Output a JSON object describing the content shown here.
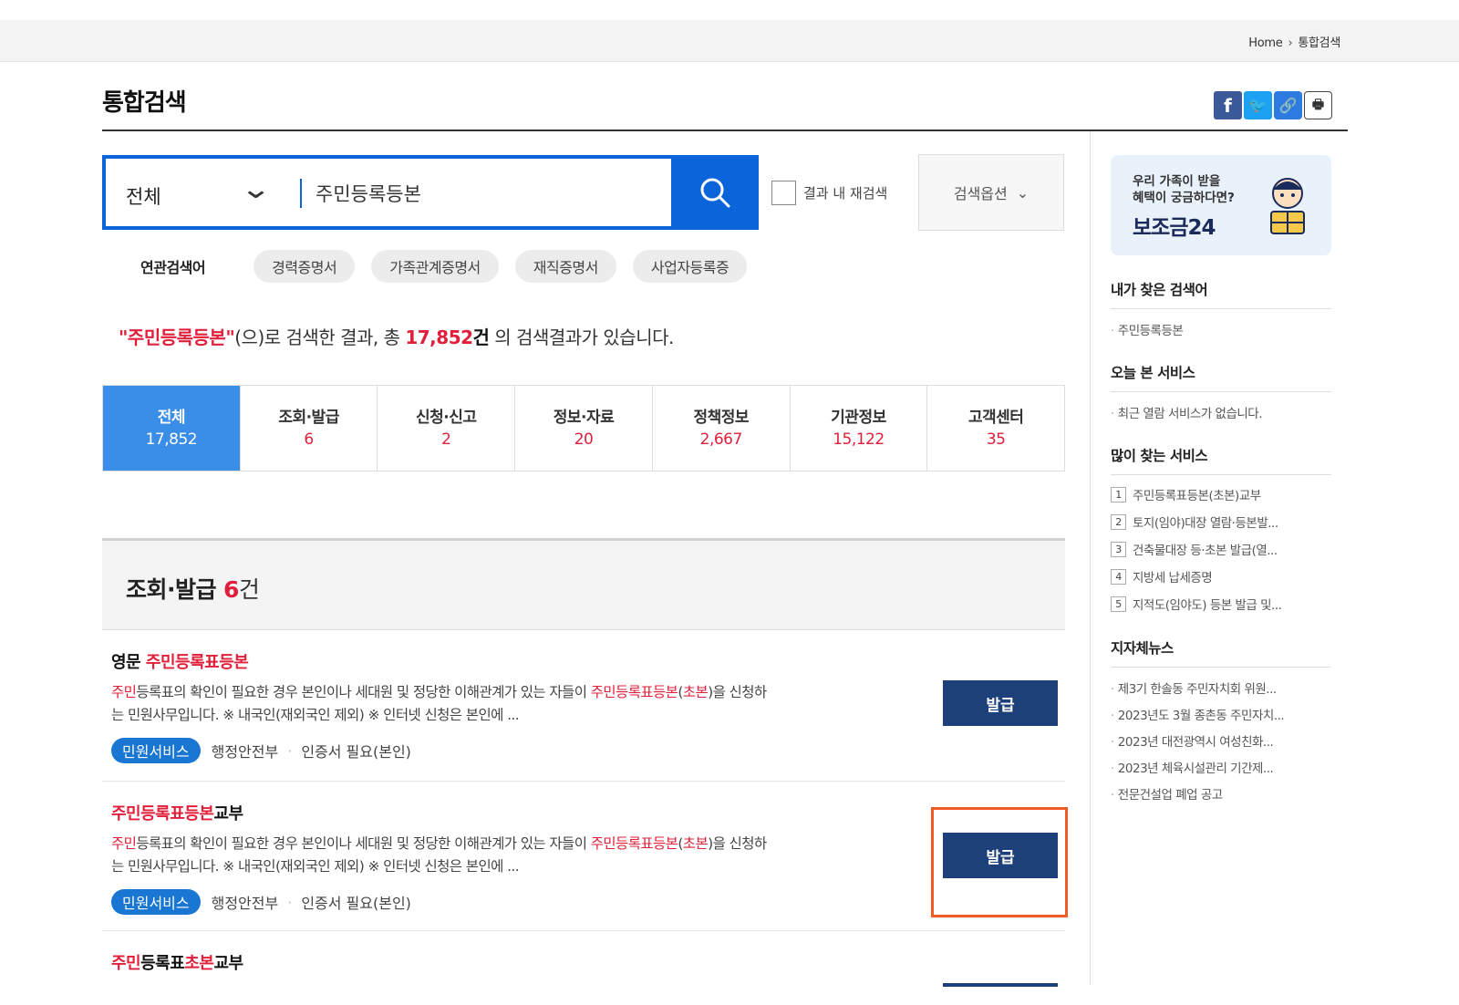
{
  "breadcrumb": {
    "home": "Home",
    "current": "통합검색"
  },
  "page_title": "통합검색",
  "share": {
    "facebook": "f",
    "twitter": "🐦",
    "link": "🔗",
    "print": "🖶"
  },
  "search": {
    "scope": "전체",
    "query": "주민등록등본",
    "research_label": "결과 내 재검색",
    "options_label": "검색옵션"
  },
  "related": {
    "label": "연관검색어",
    "terms": [
      "경력증명서",
      "가족관계증명서",
      "재직증명서",
      "사업자등록증"
    ]
  },
  "summary": {
    "keyword": "\"주민등록등본\"",
    "mid": "(으)로 검색한 결과, 총 ",
    "total": "17,852",
    "unit": "건",
    "tail": " 의 검색결과가 있습니다."
  },
  "tabs": [
    {
      "label": "전체",
      "count": "17,852",
      "active": true
    },
    {
      "label": "조회·발급",
      "count": "6"
    },
    {
      "label": "신청·신고",
      "count": "2"
    },
    {
      "label": "정보·자료",
      "count": "20"
    },
    {
      "label": "정책정보",
      "count": "2,667"
    },
    {
      "label": "기관정보",
      "count": "15,122"
    },
    {
      "label": "고객센터",
      "count": "35"
    }
  ],
  "section": {
    "title": "조회·발급",
    "count": "6",
    "unit": "건"
  },
  "results": [
    {
      "title_pre": "영문 ",
      "title_red": "주민등록표등본",
      "title_post": "",
      "desc_a": "주민",
      "desc_b": "등록표의 확인이 필요한 경우 본인이나 세대원 및 정당한 이해관계가 있는 자들이 ",
      "desc_c": "주민등록표등본",
      "desc_d": "(",
      "desc_e": "초본",
      "desc_f": ")을 신청하",
      "desc_line2": "는 민원사무입니다. ※ 내국인(재외국인 제외) ※ 인터넷 신청은 본인에 ...",
      "badge": "민원서비스",
      "agency": "행정안전부",
      "cert": "인증서 필요(본인)",
      "button": "발급"
    },
    {
      "title_pre": "",
      "title_red": "주민등록표등본",
      "title_post": "교부",
      "desc_a": "주민",
      "desc_b": "등록표의 확인이 필요한 경우 본인이나 세대원 및 정당한 이해관계가 있는 자들이 ",
      "desc_c": "주민등록표등본",
      "desc_d": "(",
      "desc_e": "초본",
      "desc_f": ")을 신청하",
      "desc_line2": "는 민원사무입니다. ※ 내국인(재외국인 제외) ※ 인터넷 신청은 본인에 ...",
      "badge": "민원서비스",
      "agency": "행정안전부",
      "cert": "인증서 필요(본인)",
      "button": "발급"
    },
    {
      "title_a": "주민",
      "title_b": "등록표",
      "title_c": "초본",
      "title_d": "교부"
    }
  ],
  "sidebar": {
    "banner_line1": "우리 가족이 받을",
    "banner_line2": "혜택이 궁금하다면?",
    "banner_title": "보조금24",
    "my_searches_title": "내가 찾은 검색어",
    "my_searches": [
      "주민등록등본"
    ],
    "today_title": "오늘 본 서비스",
    "today": [
      "최근 열람 서비스가 없습니다."
    ],
    "popular_title": "많이 찾는 서비스",
    "popular": [
      {
        "rank": "1",
        "label": "주민등록표등본(초본)교부"
      },
      {
        "rank": "2",
        "label": "토지(임야)대장 열람·등본발..."
      },
      {
        "rank": "3",
        "label": "건축물대장 등·초본 발급(열..."
      },
      {
        "rank": "4",
        "label": "지방세 납세증명"
      },
      {
        "rank": "5",
        "label": "지적도(임야도) 등본 발급 및..."
      }
    ],
    "news_title": "지자체뉴스",
    "news": [
      "제3기 한솔동 주민자치회 위원...",
      "2023년도 3월 종촌동 주민자치...",
      "2023년 대전광역시 여성친화...",
      "2023년 체육시설관리 기간제...",
      "전문건설업 폐업 공고"
    ]
  },
  "colors": {
    "accent_blue": "#0b64d9",
    "highlight": "#e0203a",
    "button_navy": "#1d3f7a",
    "annotation_box": "#f15a22"
  }
}
